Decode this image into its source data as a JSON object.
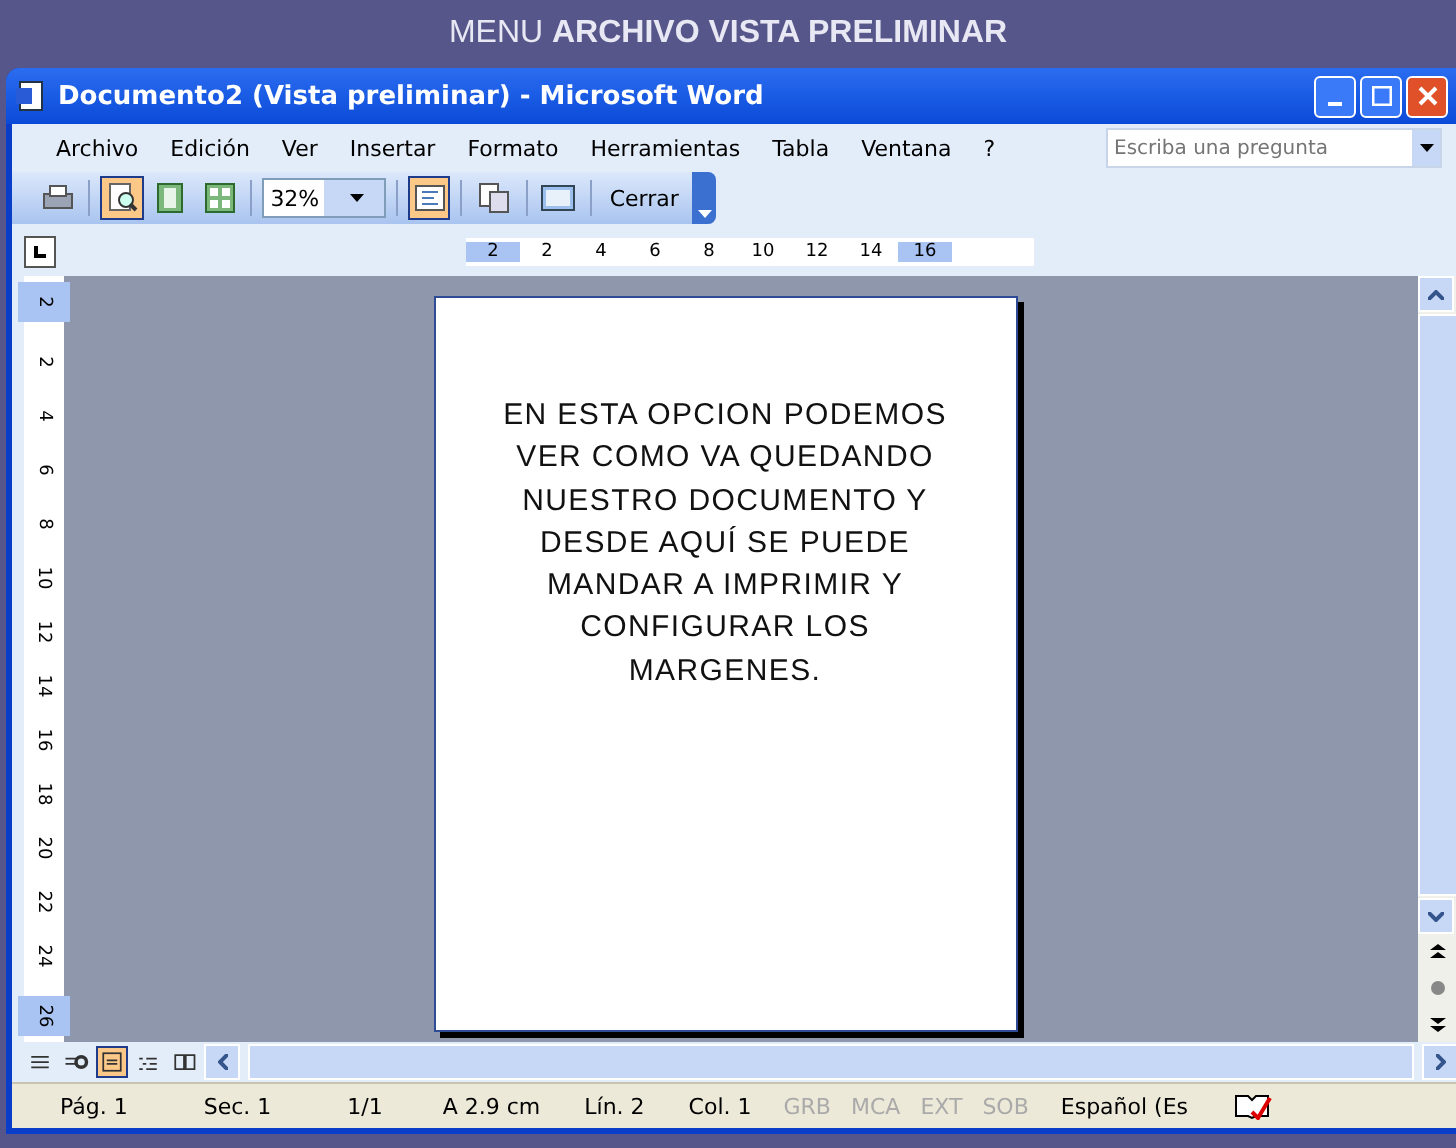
{
  "banner": {
    "text": "MENU **ARCHIVO VISTA PRELIMINAR**"
  },
  "window": {
    "title": "Documento2 (Vista preliminar) - Microsoft Word"
  },
  "menu": [
    {
      "label": "Archivo"
    },
    {
      "label": "Edición"
    },
    {
      "label": "Ver"
    },
    {
      "label": "Insertar"
    },
    {
      "label": "Formato"
    },
    {
      "label": "Herramientas"
    },
    {
      "label": "Tabla"
    },
    {
      "label": "Ventana"
    },
    {
      "label": "?"
    }
  ],
  "help_box": {
    "placeholder": "Escriba una pregunta"
  },
  "toolbar": [
    {
      "kind": "print",
      "selected": false
    },
    {
      "kind": "magnifier",
      "selected": true
    },
    {
      "kind": "one-page",
      "selected": false
    },
    {
      "kind": "multi-page",
      "selected": false
    },
    {
      "kind": "zoom",
      "value": "32%"
    },
    {
      "kind": "ruler",
      "selected": true
    },
    {
      "kind": "shrink",
      "selected": false
    },
    {
      "kind": "fullscreen",
      "selected": false
    },
    {
      "kind": "close",
      "label": "Cerrar"
    }
  ],
  "h_ruler": [
    "2",
    "2",
    "4",
    "6",
    "8",
    "10",
    "12",
    "14",
    "16"
  ],
  "v_ruler": [
    "2",
    "2",
    "4",
    "6",
    "8",
    "10",
    "12",
    "14",
    "16",
    "18",
    "20",
    "22",
    "24",
    "26"
  ],
  "page": {
    "text": "EN ESTA OPCION PODEMOS VER COMO VA QUEDANDO NUESTRO DOCUMENTO Y DESDE AQUÍ SE PUEDE MANDAR A IMPRIMIR Y CONFIGURAR LOS MARGENES."
  },
  "views": [
    {
      "kind": "normal",
      "selected": false
    },
    {
      "kind": "web",
      "selected": false
    },
    {
      "kind": "print",
      "selected": true
    },
    {
      "kind": "outline",
      "selected": false
    },
    {
      "kind": "reading",
      "selected": false
    }
  ],
  "status": [
    {
      "text": "Pág. 1",
      "disabled": false
    },
    {
      "text": "Sec. 1",
      "disabled": false
    },
    {
      "text": "1/1",
      "disabled": false
    },
    {
      "text": "A  2.9 cm",
      "disabled": false
    },
    {
      "text": "Lín. 2",
      "disabled": false
    },
    {
      "text": "Col. 1",
      "disabled": false
    },
    {
      "text": "GRB",
      "disabled": true
    },
    {
      "text": "MCA",
      "disabled": true
    },
    {
      "text": "EXT",
      "disabled": true
    },
    {
      "text": "SOB",
      "disabled": true
    },
    {
      "text": "Español (Es",
      "disabled": false
    }
  ]
}
